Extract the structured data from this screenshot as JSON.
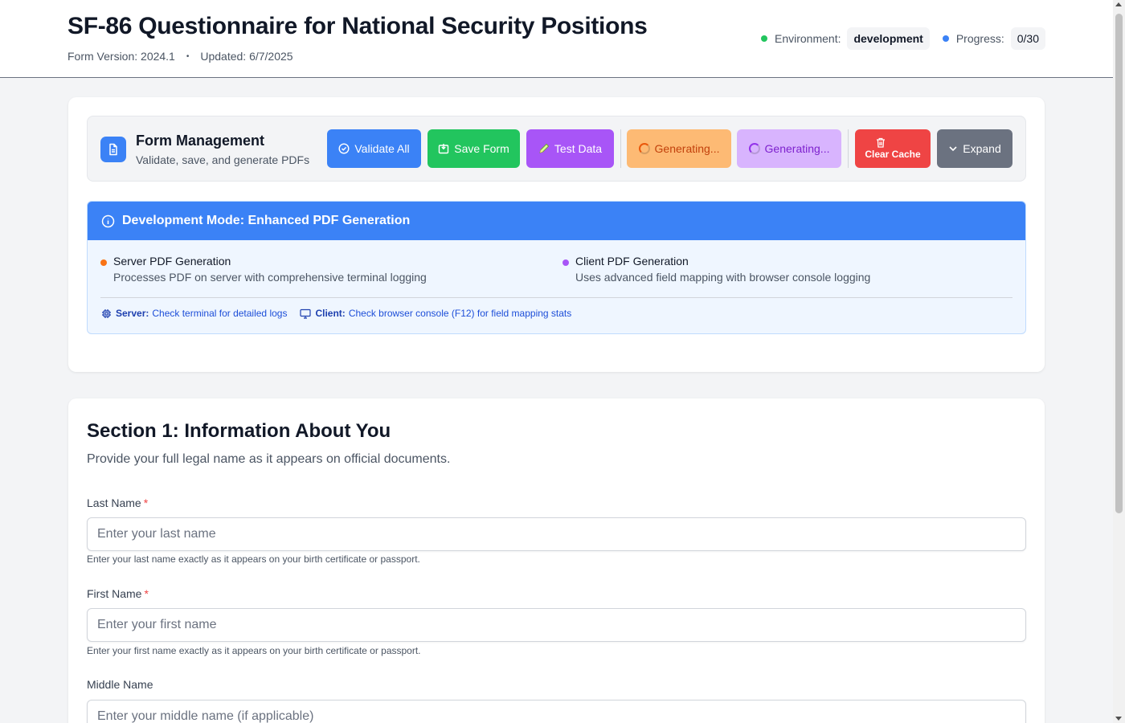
{
  "header": {
    "title": "SF-86 Questionnaire for National Security Positions",
    "form_version": "Form Version: 2024.1",
    "separator": "•",
    "updated": "Updated: 6/7/2025",
    "environment_label": "Environment:",
    "environment_value": "development",
    "environment_dot_color": "#22c55e",
    "progress_label": "Progress:",
    "progress_value": "0/30",
    "progress_dot_color": "#3b82f6"
  },
  "form_management": {
    "icon": "document-icon",
    "title": "Form Management",
    "subtitle": "Validate, save, and generate PDFs",
    "buttons": {
      "validate": "Validate All",
      "save": "Save Form",
      "test": "Test Data",
      "generating_server": "Generating...",
      "generating_client": "Generating...",
      "clear_cache": "Clear Cache",
      "expand": "Expand"
    }
  },
  "dev_mode": {
    "title": "Development Mode: Enhanced PDF Generation",
    "server": {
      "title": "Server PDF Generation",
      "description": "Processes PDF on server with comprehensive terminal logging",
      "dot_color": "#f97316"
    },
    "client": {
      "title": "Client PDF Generation",
      "description": "Uses advanced field mapping with browser console logging",
      "dot_color": "#a855f7"
    },
    "footer": {
      "server_label": "Server:",
      "server_text": "Check terminal for detailed logs",
      "client_label": "Client:",
      "client_text": "Check browser console (F12) for field mapping stats"
    }
  },
  "section1": {
    "title": "Section 1: Information About You",
    "subtitle": "Provide your full legal name as it appears on official documents.",
    "fields": [
      {
        "label": "Last Name",
        "required": "*",
        "value": "",
        "placeholder": "Enter your last name",
        "help": "Enter your last name exactly as it appears on your birth certificate or passport."
      },
      {
        "label": "First Name",
        "required": "*",
        "value": "",
        "placeholder": "Enter your first name",
        "help": "Enter your first name exactly as it appears on your birth certificate or passport."
      },
      {
        "label": "Middle Name",
        "value": "",
        "placeholder": "Enter your middle name (if applicable)"
      }
    ]
  }
}
